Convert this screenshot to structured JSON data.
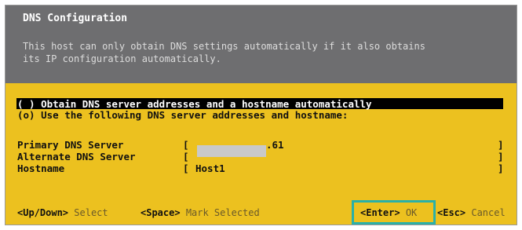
{
  "dialog": {
    "title": "DNS Configuration",
    "description_line1": "This host can only obtain DNS settings automatically if it also obtains",
    "description_line2": "its IP configuration automatically."
  },
  "options": [
    {
      "marker": "( )",
      "label": "Obtain DNS server addresses and a hostname automatically",
      "selected": false,
      "highlighted": true
    },
    {
      "marker": "(o)",
      "label": "Use the following DNS server addresses and hostname:",
      "selected": true,
      "highlighted": false
    }
  ],
  "fields": {
    "primary_dns": {
      "label": "Primary DNS Server",
      "value": ".61",
      "open": "[",
      "close": "]"
    },
    "alternate_dns": {
      "label": "Alternate DNS Server",
      "value": "",
      "open": "[",
      "close": "]"
    },
    "hostname": {
      "label": "Hostname",
      "value": "Host1",
      "open": "[",
      "close": "]"
    }
  },
  "footer": {
    "updown_key": "<Up/Down>",
    "updown_action": "Select",
    "space_key": "<Space>",
    "space_action": "Mark Selected",
    "enter_key": "<Enter>",
    "enter_action": "OK",
    "esc_key": "<Esc>",
    "esc_action": "Cancel"
  },
  "colors": {
    "header_bg": "#6e6e70",
    "body_bg": "#ecc11f",
    "highlight_bg": "#000000",
    "ok_callout": "#2ab0a8"
  }
}
